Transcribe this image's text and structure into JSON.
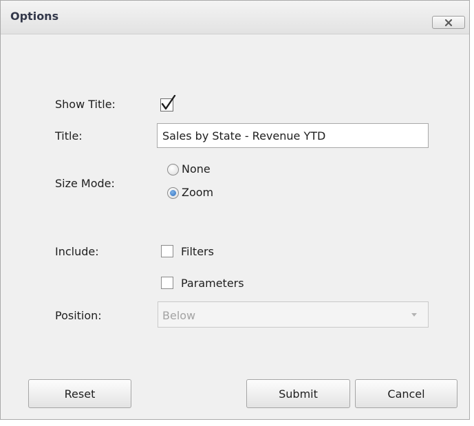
{
  "dialog": {
    "title": "Options",
    "close_icon": "close-icon"
  },
  "form": {
    "show_title_label": "Show Title:",
    "show_title_checked": true,
    "title_label": "Title:",
    "title_value": "Sales by State - Revenue YTD",
    "size_mode_label": "Size Mode:",
    "size_mode_options": [
      {
        "label": "None",
        "selected": false
      },
      {
        "label": "Zoom",
        "selected": true
      }
    ],
    "include_label": "Include:",
    "include_options": [
      {
        "label": "Filters",
        "checked": false
      },
      {
        "label": "Parameters",
        "checked": false
      }
    ],
    "position_label": "Position:",
    "position_value": "Below",
    "position_disabled": true
  },
  "buttons": {
    "reset": "Reset",
    "submit": "Submit",
    "cancel": "Cancel"
  }
}
